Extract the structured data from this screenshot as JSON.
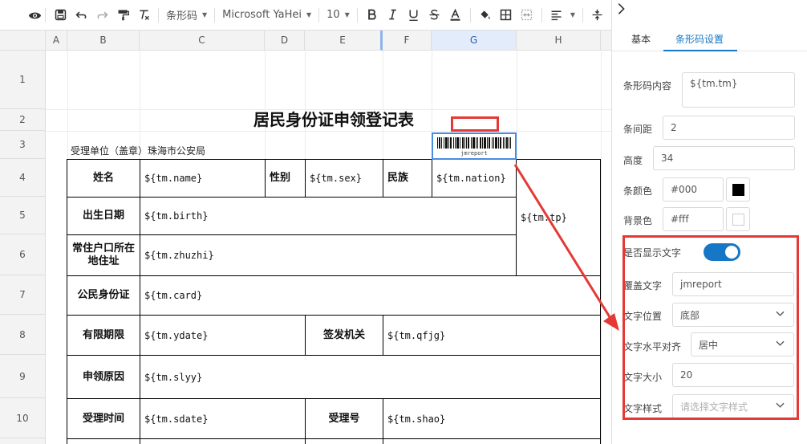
{
  "toolbar": {
    "cell_type": "条形码",
    "font_family": "Microsoft YaHei",
    "font_size": "10"
  },
  "sheet": {
    "columns": [
      "A",
      "B",
      "C",
      "D",
      "E",
      "F",
      "G",
      "H"
    ],
    "rows": [
      "1",
      "2",
      "3",
      "4",
      "5",
      "6",
      "7",
      "8",
      "9",
      "10"
    ],
    "title": "居民身份证申领登记表",
    "unit_label": "受理单位（盖章）珠海市公安局",
    "barcode_text": "jmreport",
    "cells": {
      "name_label": "姓名",
      "name_value": "${tm.name}",
      "sex_label": "性别",
      "sex_value": "${tm.sex}",
      "nation_label": "民族",
      "nation_value": "${tm.nation}",
      "birth_label": "出生日期",
      "birth_value": "${tm.birth}",
      "photo_value": "${tm.tp}",
      "address_label": "常住户口所在地住址",
      "address_value": "${tm.zhuzhi}",
      "card_label": "公民身份证",
      "card_value": "${tm.card}",
      "validity_label": "有限期限",
      "validity_value": "${tm.ydate}",
      "issuer_label": "签发机关",
      "issuer_value": "${tm.qfjg}",
      "reason_label": "申领原因",
      "reason_value": "${tm.slyy}",
      "accept_time_label": "受理时间",
      "accept_time_value": "${tm.sdate}",
      "accept_no_label": "受理号",
      "accept_no_value": "${tm.shao}"
    }
  },
  "panel": {
    "tabs": [
      "基本",
      "条形码设置"
    ],
    "active_tab": "条形码设置",
    "fields": {
      "content_label": "条形码内容",
      "content_value": "${tm.tm}",
      "spacing_label": "条间距",
      "spacing_value": "2",
      "height_label": "高度",
      "height_value": "34",
      "bar_color_label": "条颜色",
      "bar_color_value": "#000",
      "bg_color_label": "背景色",
      "bg_color_value": "#fff",
      "show_text_label": "是否显示文字",
      "show_text_on": true,
      "override_text_label": "覆盖文字",
      "override_text_value": "jmreport",
      "text_position_label": "文字位置",
      "text_position_value": "底部",
      "text_align_label": "文字水平对齐",
      "text_align_value": "居中",
      "text_size_label": "文字大小",
      "text_size_value": "20",
      "text_style_label": "文字样式",
      "text_style_placeholder": "请选择文字样式"
    }
  },
  "colors": {
    "accent": "#1677c6",
    "highlight": "#e53935",
    "selection": "#4a8be0"
  }
}
